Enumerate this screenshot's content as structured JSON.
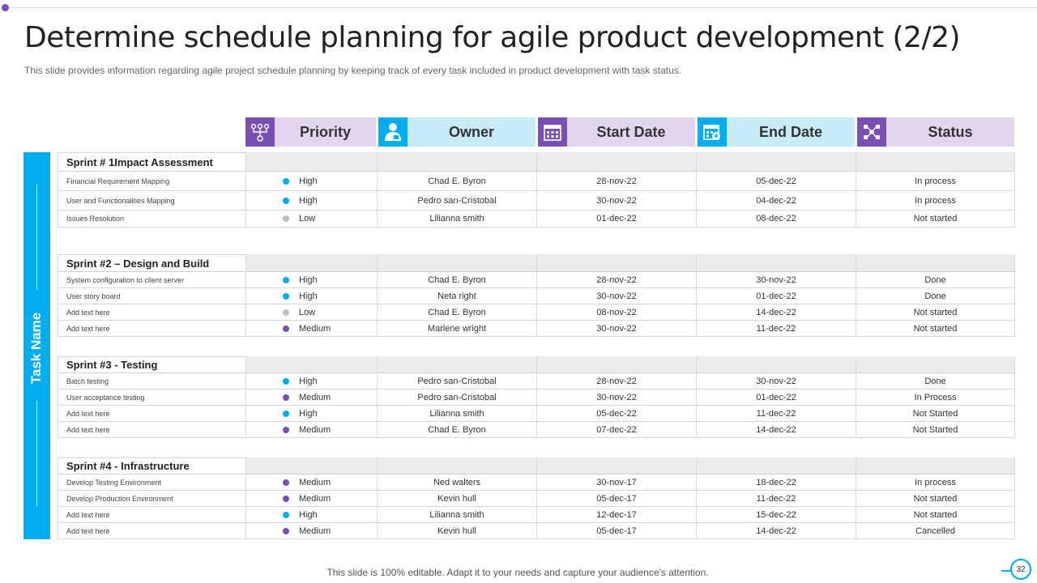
{
  "title": "Determine schedule planning for agile product development (2/2)",
  "subtitle": "This slide provides information regarding agile project schedule planning by keeping track of every  task included in product development with task status.",
  "side_label": "Task Name",
  "columns": [
    {
      "label": "Priority",
      "icon": "workflow-icon",
      "color": "purple"
    },
    {
      "label": "Owner",
      "icon": "person-icon",
      "color": "blue"
    },
    {
      "label": "Start Date",
      "icon": "calendar-icon",
      "color": "purple"
    },
    {
      "label": "End Date",
      "icon": "calendar-add-icon",
      "color": "blue"
    },
    {
      "label": "Status",
      "icon": "network-icon",
      "color": "purple"
    }
  ],
  "priority_colors": {
    "High": "#00aeef",
    "Low": "#bfbfbf",
    "Medium": "#7a4fb4"
  },
  "sprints": [
    {
      "name": "Sprint # 1Impact Assessment",
      "rows": [
        {
          "task": "Financial Requirement Mapping",
          "priority": "High",
          "owner": "Chad E. Byron",
          "start": "28-nov-22",
          "end": "05-dec-22",
          "status": "In process"
        },
        {
          "task": "User and Functionalities Mapping",
          "priority": "High",
          "owner": "Pedro san-Cristobal",
          "start": "30-nov-22",
          "end": "04-dec-22",
          "status": "In process"
        },
        {
          "task": "Issues Resolution",
          "priority": "Low",
          "owner": "Lilianna smith",
          "start": "01-dec-22",
          "end": "08-dec-22",
          "status": "Not started"
        }
      ]
    },
    {
      "name": "Sprint #2 – Design and Build",
      "rows": [
        {
          "task": "System configuration to client server",
          "priority": "High",
          "owner": "Chad E. Byron",
          "start": "28-nov-22",
          "end": "30-nov-22",
          "status": "Done"
        },
        {
          "task": "User story board",
          "priority": "High",
          "owner": "Neta right",
          "start": "30-nov-22",
          "end": "01-dec-22",
          "status": "Done"
        },
        {
          "task": "Add text here",
          "priority": "Low",
          "owner": "Chad E. Byron",
          "start": "08-nov-22",
          "end": "14-dec-22",
          "status": "Not started"
        },
        {
          "task": "Add text here",
          "priority": "Medium",
          "owner": "Marlene wright",
          "start": "30-nov-22",
          "end": "11-dec-22",
          "status": "Not started"
        }
      ]
    },
    {
      "name": "Sprint #3 - Testing",
      "rows": [
        {
          "task": "Batch testing",
          "priority": "High",
          "owner": "Pedro san-Cristobal",
          "start": "28-nov-22",
          "end": "30-nov-22",
          "status": "Done"
        },
        {
          "task": "User acceptance testing",
          "priority": "Medium",
          "owner": "Pedro san-Cristobal",
          "start": "30-nov-22",
          "end": "01-dec-22",
          "status": "In Process"
        },
        {
          "task": "Add text here",
          "priority": "High",
          "owner": "Lilianna smith",
          "start": "05-dec-22",
          "end": "11-dec-22",
          "status": "Not Started"
        },
        {
          "task": "Add text here",
          "priority": "Medium",
          "owner": "Chad E. Byron",
          "start": "07-dec-22",
          "end": "14-dec-22",
          "status": "Not Started"
        }
      ]
    },
    {
      "name": "Sprint #4 - Infrastructure",
      "rows": [
        {
          "task": "Develop Testing Environment",
          "priority": "Medium",
          "owner": "Ned walters",
          "start": "30-nov-17",
          "end": "18-dec-22",
          "status": "In process"
        },
        {
          "task": "Develop Production Environment",
          "priority": "Medium",
          "owner": "Kevin hull",
          "start": "05-dec-17",
          "end": "11-dec-22",
          "status": "Not started"
        },
        {
          "task": "Add text here",
          "priority": "High",
          "owner": "Lilianna smith",
          "start": "12-dec-17",
          "end": "15-dec-22",
          "status": "Not started"
        },
        {
          "task": "Add text here",
          "priority": "Medium",
          "owner": "Kevin hull",
          "start": "05-dec-17",
          "end": "14-dec-22",
          "status": "Cancelled"
        }
      ]
    }
  ],
  "footer": "This slide is 100% editable. Adapt it to your needs and capture your audience's attention.",
  "page_number": "32"
}
